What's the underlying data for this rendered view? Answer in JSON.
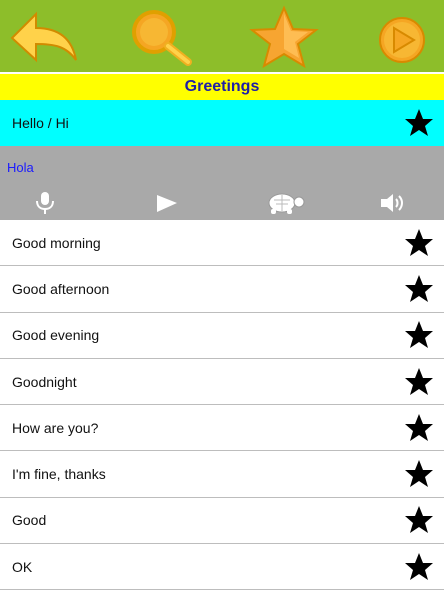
{
  "toolbar": {
    "back_icon": "back-arrow-icon",
    "search_icon": "magnifier-icon",
    "favorites_icon": "star-icon",
    "play_icon": "play-circle-icon",
    "background_color": "#8dbe2a",
    "accent_color": "#f5a623"
  },
  "section": {
    "title": "Greetings"
  },
  "selected_phrase": {
    "label": "Hello / Hi",
    "translation": "Hola",
    "favorite_icon": "star-icon"
  },
  "controls": {
    "record_icon": "microphone-icon",
    "play_icon": "play-icon",
    "slow_icon": "turtle-icon",
    "speaker_icon": "speaker-icon"
  },
  "phrases": [
    {
      "label": "Good morning"
    },
    {
      "label": "Good afternoon"
    },
    {
      "label": "Good evening"
    },
    {
      "label": "Goodnight"
    },
    {
      "label": "How are you?"
    },
    {
      "label": "I'm fine, thanks"
    },
    {
      "label": "Good"
    },
    {
      "label": "OK"
    }
  ]
}
